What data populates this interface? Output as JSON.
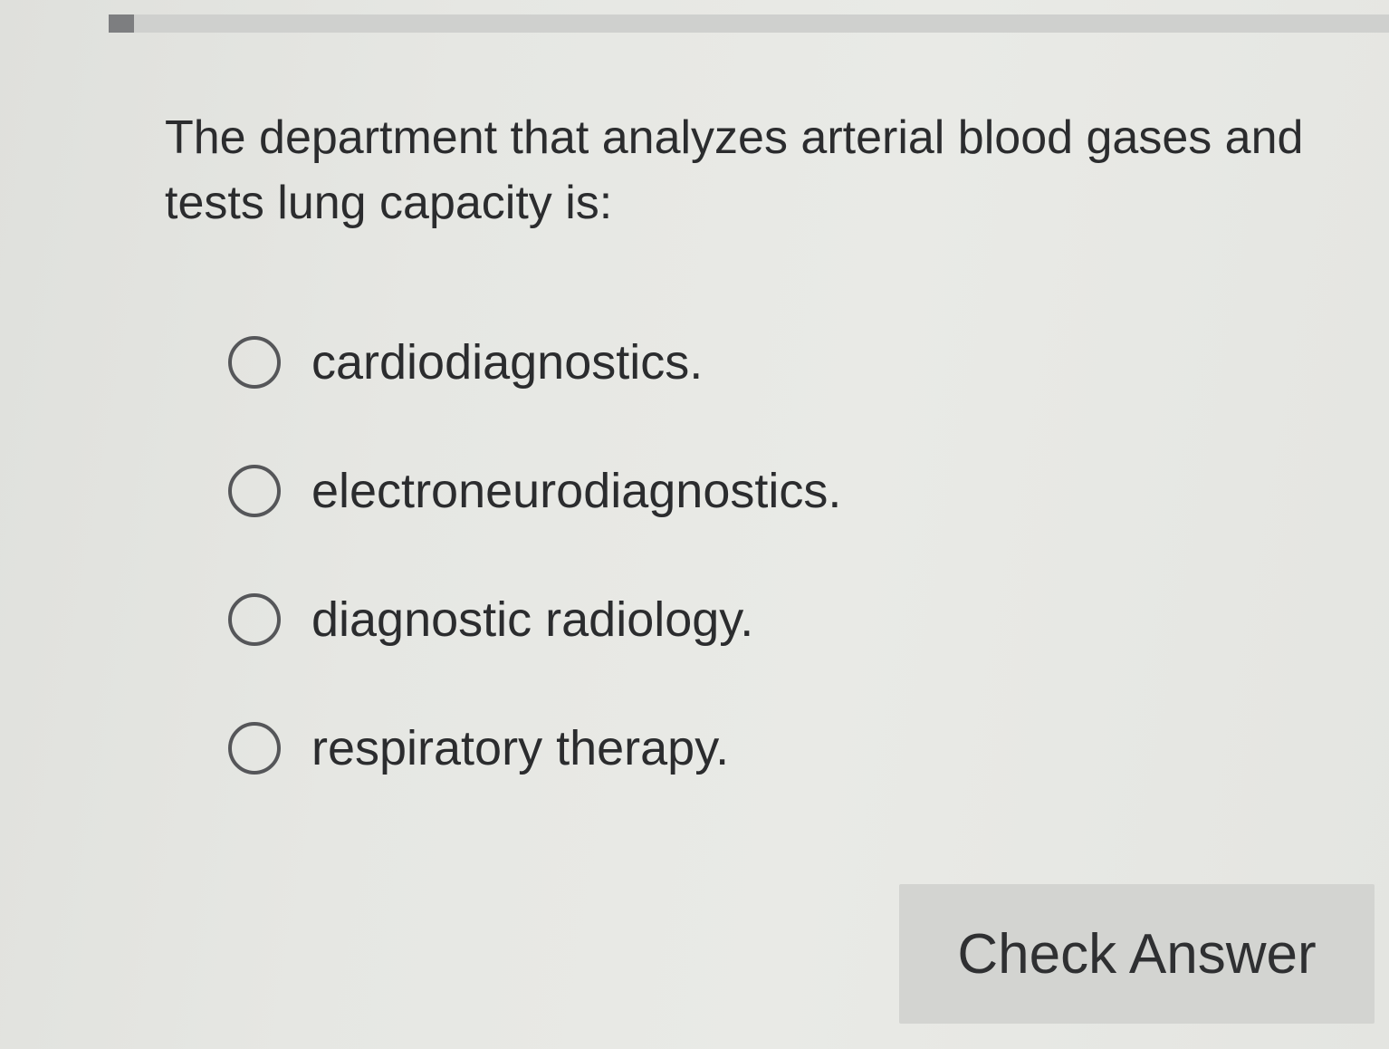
{
  "progress": {
    "fraction": 0.02
  },
  "question": {
    "text": "The department that analyzes arterial blood gases and tests lung capacity is:"
  },
  "options": [
    {
      "label": "cardiodiagnostics.",
      "selected": false
    },
    {
      "label": "electroneurodiagnostics.",
      "selected": false
    },
    {
      "label": "diagnostic radiology.",
      "selected": false
    },
    {
      "label": "respiratory therapy.",
      "selected": false
    }
  ],
  "actions": {
    "check_label": "Check Answer"
  },
  "colors": {
    "background": "#e6e7e3",
    "text": "#2b2c2e",
    "button": "#d3d4d1",
    "progress_track": "#cfd0ce",
    "progress_fill": "#7d7e80"
  }
}
